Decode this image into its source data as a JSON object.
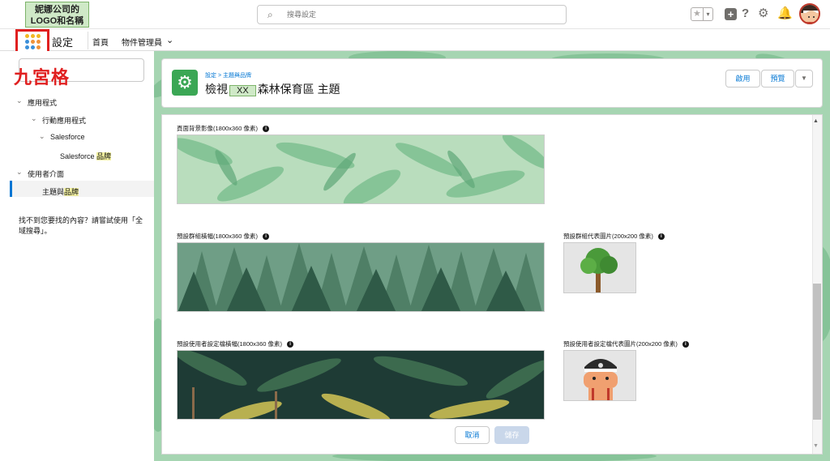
{
  "header": {
    "logo_line1": "妮娜公司的",
    "logo_line2": "LOGO和名稱",
    "search_placeholder": "搜尋設定"
  },
  "nav": {
    "annotation": "九宮格",
    "app_name": "設定",
    "tabs": [
      {
        "label": "首頁"
      },
      {
        "label": "物件管理員"
      }
    ]
  },
  "sidebar": {
    "tree": [
      {
        "label": "應用程式",
        "level": 1,
        "expanded": true
      },
      {
        "label": "行動應用程式",
        "level": 2,
        "expanded": true
      },
      {
        "label": "Salesforce",
        "level": 3,
        "expanded": true
      },
      {
        "label_pre": "Salesforce ",
        "label_hl": "品牌",
        "level": 4
      },
      {
        "label": "使用者介面",
        "level": 1,
        "expanded": true
      },
      {
        "label_pre": "主題與",
        "label_hl": "品牌",
        "level": 2,
        "selected": true
      }
    ],
    "not_found": "找不到您要找的內容？請嘗試使用「全域搜尋」。"
  },
  "page_header": {
    "crumb_root": "設定",
    "crumb_sep": " > ",
    "crumb_current": "主題與品牌",
    "title_pre": "檢視",
    "title_xx": "XX",
    "title_post": "森林保育區 主題",
    "enable_label": "啟用",
    "preview_label": "預覽",
    "more_icon": "chevron-down-icon"
  },
  "fields": {
    "page_bg": "頁面背景影像(1800x360 像素)",
    "group_banner": "預設群組橫幅(1800x360 像素)",
    "group_avatar": "預設群組代表圖片(200x200 像素)",
    "profile_banner": "預設使用者設定檔橫幅(1800x360 像素)",
    "profile_avatar": "預設使用者設定檔代表圖片(200x200 像素)"
  },
  "footer": {
    "cancel_label": "取消",
    "save_label": "儲存"
  },
  "colors": {
    "brand": "#0176d3",
    "theme_green": "#3ba755",
    "annotation_red": "#e02020",
    "forest_dark": "#2f5a47"
  }
}
